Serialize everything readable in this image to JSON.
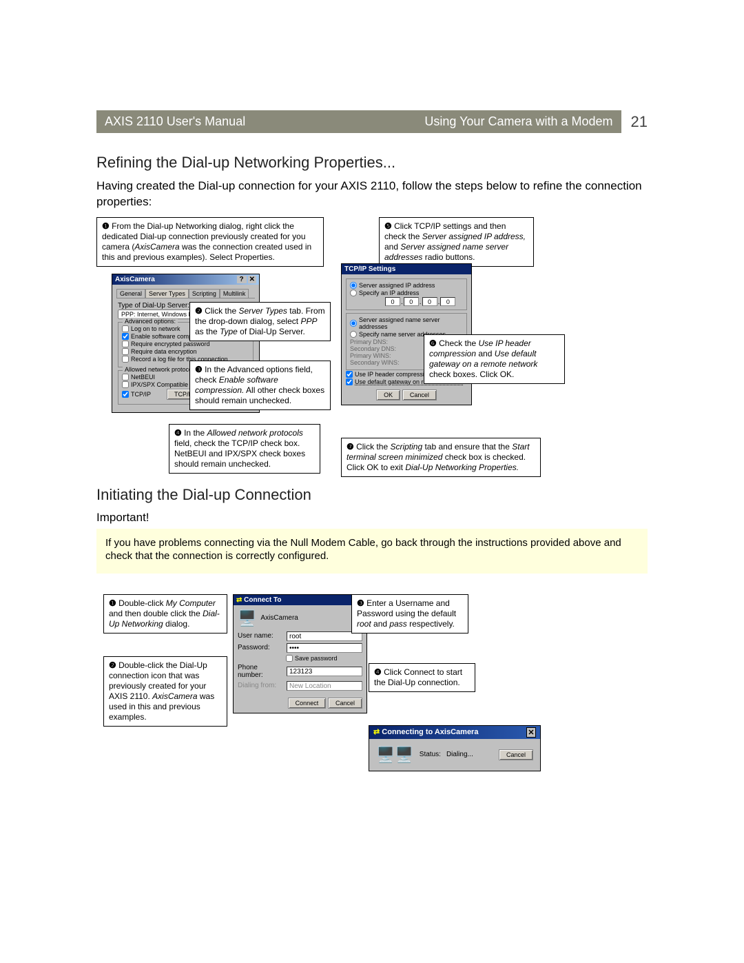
{
  "header": {
    "left": "AXIS 2110 User's Manual",
    "right": "Using Your Camera with a Modem",
    "page": "21"
  },
  "section1": {
    "title": "Refining the Dial-up Networking Properties...",
    "intro": "Having created the Dial-up connection for your AXIS 2110, follow the steps below to refine the connection properties:"
  },
  "callouts1": {
    "c1": {
      "num": "❶",
      "t1": " From the Dial-up Networking dialog, right click the dedicated Dial-up connection previously created for you camera (",
      "i1": "AxisCamera",
      "t2": " was the connection created used in this and previous examples). Select Properties."
    },
    "c2": {
      "num": "❷",
      "t1": " Click the ",
      "i1": "Server Types",
      "t2": " tab. From the drop-down dialog, select ",
      "i2": "PPP",
      "t3": " as the ",
      "i3": "Type",
      "t4": " of Dial-Up Server."
    },
    "c3": {
      "num": "❸",
      "t1": " In the Advanced options field, check ",
      "i1": "Enable software compression.",
      "t2": " All other check boxes should remain unchecked."
    },
    "c4": {
      "num": "❹",
      "t1": " In the ",
      "i1": "Allowed network protocols",
      "t2": " field, check the TCP/IP check box. NetBEUI and IPX/SPX check boxes should remain unchecked."
    },
    "c5": {
      "num": "❺",
      "t1": " Click TCP/IP settings and then check the ",
      "i1": "Server assigned IP address,",
      "t2": " and ",
      "i2": "Server assigned name server addresses",
      "t3": " radio buttons."
    },
    "c6": {
      "num": "❻",
      "t1": " Check the ",
      "i1": "Use IP header compression",
      "t2": " and ",
      "i2": "Use default gateway on a remote network",
      "t3": " check boxes. Click OK."
    },
    "c7": {
      "num": "❼",
      "t1": " Click the ",
      "i1": "Scripting",
      "t2": " tab and ensure that the ",
      "i2": "Start terminal screen minimized",
      "t3": " check box is checked. Click OK to exit ",
      "i3": "Dial-Up Networking Properties."
    }
  },
  "dlg1": {
    "title": "AxisCamera",
    "tabs": {
      "general": "General",
      "server": "Server Types",
      "scripting": "Scripting",
      "multilink": "Multilink"
    },
    "type_label": "Type of Dial-Up Server:",
    "type_value": "PPP: Internet, Windows NT",
    "adv_label": "Advanced options:",
    "adv_logon": "Log on to network",
    "adv_soft": "Enable software compression",
    "adv_enc": "Require encrypted password",
    "adv_dataenc": "Require data encryption",
    "adv_log": "Record a log file for this connection",
    "net_label": "Allowed network protocols:",
    "net_beui": "NetBEUI",
    "net_ipx": "IPX/SPX Compatible",
    "net_tcp": "TCP/IP",
    "btn_tcpip": "TCP/IP Settings..."
  },
  "dlg2": {
    "title": "TCP/IP Settings",
    "r_srvip": "Server assigned IP address",
    "r_specip": "Specify an IP address",
    "ipvals": [
      "0",
      "0",
      "0",
      "0"
    ],
    "r_srv_ns": "Server assigned name server addresses",
    "r_spec_ns": "Specify name server addresses",
    "lbl_pdns": "Primary DNS:",
    "lbl_sdns": "Secondary DNS:",
    "lbl_pwins": "Primary WINS:",
    "lbl_swins": "Secondary WINS:",
    "chk_iphdr": "Use IP header compression",
    "chk_gw": "Use default gateway on remote network",
    "btn_ok": "OK",
    "btn_cancel": "Cancel"
  },
  "section2": {
    "title": "Initiating the Dial-up Connection",
    "important_label": "Important!",
    "note": "If you have problems connecting via the Null Modem Cable, go back through the instructions provided above and check that the connection is correctly configured."
  },
  "callouts2": {
    "c1": {
      "num": "❶",
      "t1": " Double-click ",
      "i1": "My Computer",
      "t2": " and then double click the ",
      "i2": "Dial-Up Networking",
      "t3": " dialog."
    },
    "c2": {
      "num": "❷",
      "t1": " Double-click the Dial-Up connection icon that was previously created for your AXIS 2110. ",
      "i1": "AxisCamera",
      "t2": " was used in this and previous examples."
    },
    "c3": {
      "num": "❸",
      "t1": " Enter a Username and Password using the default ",
      "i1": "root",
      "t2": " and ",
      "i2": "pass",
      "t3": " respectively."
    },
    "c4": {
      "num": "❹",
      "t1": " Click Connect to start the Dial-Up connection."
    }
  },
  "dlg3": {
    "title": "Connect To",
    "name": "AxisCamera",
    "user_lbl": "User name:",
    "user_val": "root",
    "pass_lbl": "Password:",
    "pass_val": "••••",
    "save_pw": "Save password",
    "phone_lbl": "Phone number:",
    "phone_val": "123123",
    "dial_lbl": "Dialing from:",
    "dial_val": "New Location",
    "btn_connect": "Connect",
    "btn_cancel": "Cancel"
  },
  "dlg4": {
    "title": "Connecting to AxisCamera",
    "status_lbl": "Status:",
    "status_val": "Dialing...",
    "btn_cancel": "Cancel",
    "close_x": "✕"
  }
}
